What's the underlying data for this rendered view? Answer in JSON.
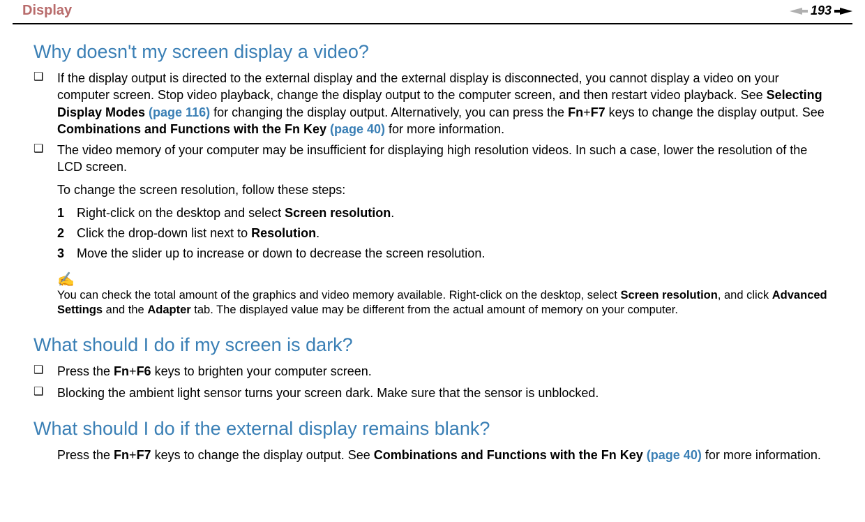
{
  "header": {
    "breadcrumb": "Display",
    "page_number": "193"
  },
  "section1": {
    "title": "Why doesn't my screen display a video?",
    "b1_pre": "If the display output is directed to the external display and the external display is disconnected, you cannot display a video on your computer screen. Stop video playback, change the display output to the computer screen, and then restart video playback. See ",
    "b1_bold1": "Selecting Display Modes",
    "b1_link1": " (page 116)",
    "b1_mid1": " for changing the display output. Alternatively, you can press the ",
    "b1_bold2": "Fn",
    "b1_plus": "+",
    "b1_bold3": "F7",
    "b1_mid2": " keys to change the display output. See ",
    "b1_bold4": "Combinations and Functions with the Fn Key",
    "b1_link2": " (page 40)",
    "b1_end": " for more information.",
    "b2": "The video memory of your computer may be insufficient for displaying high resolution videos. In such a case, lower the resolution of the LCD screen.",
    "b2_sub": "To change the screen resolution, follow these steps:",
    "n1_pre": "Right-click on the desktop and select ",
    "n1_bold": "Screen resolution",
    "n1_end": ".",
    "n2_pre": "Click the drop-down list next to ",
    "n2_bold": "Resolution",
    "n2_end": ".",
    "n3": "Move the slider up to increase or down to decrease the screen resolution.",
    "note_icon": "✍",
    "note_pre": "You can check the total amount of the graphics and video memory available. Right-click on the desktop, select ",
    "note_b1": "Screen resolution",
    "note_mid1": ", and click ",
    "note_b2": "Advanced Settings",
    "note_mid2": " and the ",
    "note_b3": "Adapter",
    "note_end": " tab. The displayed value may be different from the actual amount of memory on your computer."
  },
  "section2": {
    "title": "What should I do if my screen is dark?",
    "b1_pre": "Press the ",
    "b1_b1": "Fn",
    "b1_plus": "+",
    "b1_b2": "F6",
    "b1_end": " keys to brighten your computer screen.",
    "b2": "Blocking the ambient light sensor turns your screen dark. Make sure that the sensor is unblocked."
  },
  "section3": {
    "title": "What should I do if the external display remains blank?",
    "p_pre": "Press the ",
    "p_b1": "Fn",
    "p_plus": "+",
    "p_b2": "F7",
    "p_mid": " keys to change the display output. See ",
    "p_b3": "Combinations and Functions with the Fn Key",
    "p_link": " (page 40)",
    "p_end": " for more information."
  },
  "markers": {
    "square": "❑",
    "one": "1",
    "two": "2",
    "three": "3"
  }
}
